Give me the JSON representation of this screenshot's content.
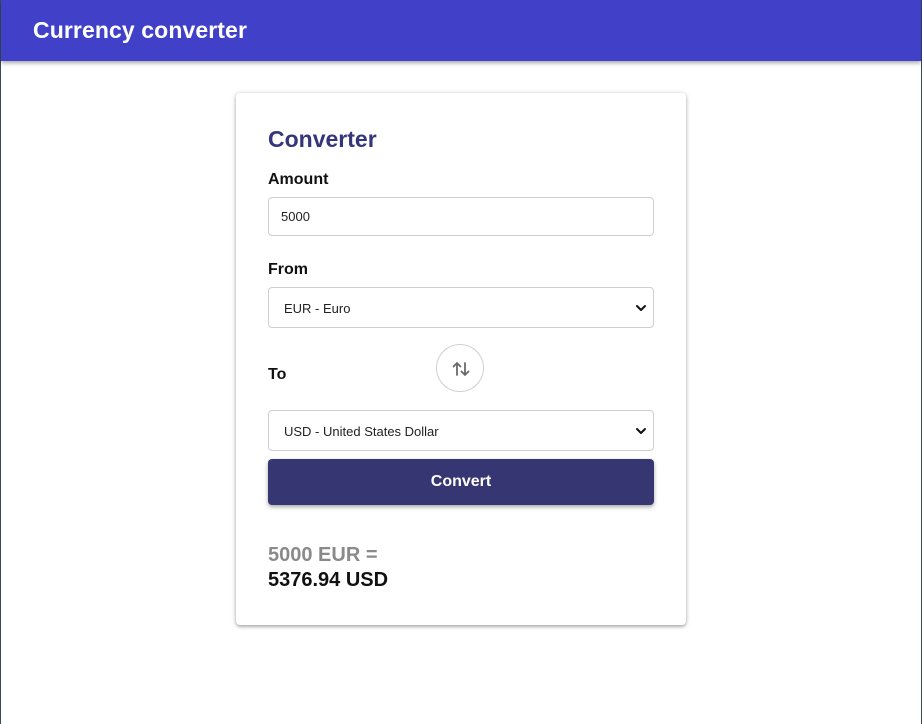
{
  "app_bar": {
    "title": "Currency converter",
    "color": "#4040c8"
  },
  "converter": {
    "title": "Converter",
    "amount": {
      "label": "Amount",
      "value": "5000"
    },
    "from": {
      "label": "From",
      "selected": "EUR - Euro"
    },
    "to": {
      "label": "To",
      "selected": "USD - United States Dollar"
    },
    "swap_icon": "swap-vertical-arrows-icon",
    "convert_label": "Convert",
    "button_color": "#363673",
    "result": {
      "from_text": "5000 EUR =",
      "to_text": "5376.94 USD"
    }
  }
}
